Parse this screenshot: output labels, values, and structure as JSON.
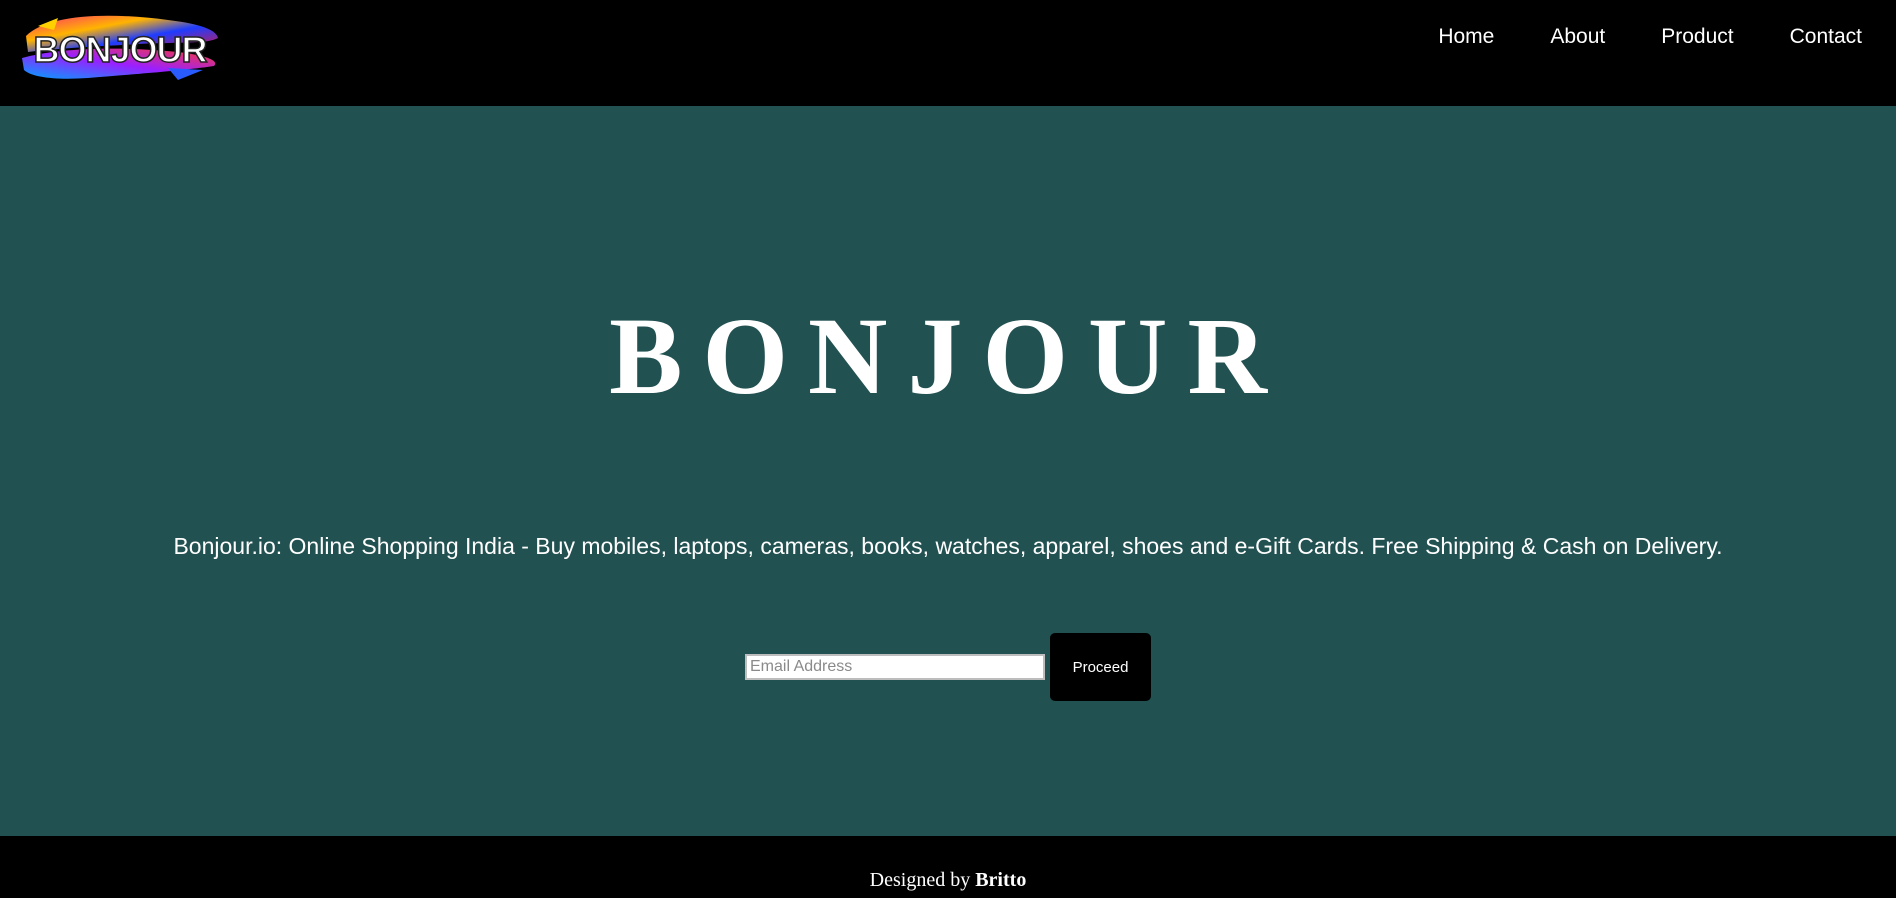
{
  "brand": {
    "logo_text": "BONJOUR",
    "logo_icon": "brush-stroke-logo"
  },
  "nav": {
    "items": [
      {
        "label": "Home"
      },
      {
        "label": "About"
      },
      {
        "label": "Product"
      },
      {
        "label": "Contact"
      }
    ]
  },
  "hero": {
    "title": "BONJOUR",
    "tagline": "Bonjour.io: Online Shopping India - Buy mobiles, laptops, cameras, books, watches, apparel, shoes and e-Gift Cards. Free Shipping & Cash on Delivery.",
    "email_placeholder": "Email Address",
    "email_value": "",
    "proceed_label": "Proceed"
  },
  "footer": {
    "designed_by_prefix": "Designed by",
    "designer_name": "Britto"
  },
  "colors": {
    "hero_background": "#225152",
    "nav_background": "#000000",
    "footer_background": "#000000",
    "button_background": "#000000",
    "text": "#ffffff"
  }
}
